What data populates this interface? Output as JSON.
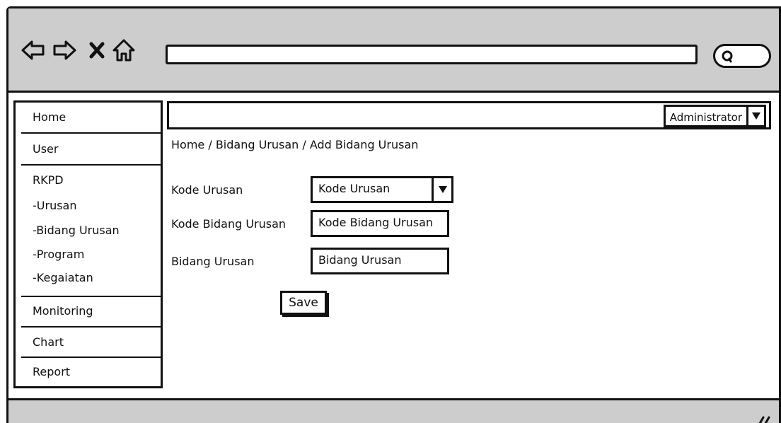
{
  "sidebar": {
    "items": [
      {
        "label": "Home"
      },
      {
        "label": "User"
      },
      {
        "label": "RKPD"
      },
      {
        "label": "-Urusan"
      },
      {
        "label": "-Bidang Urusan"
      },
      {
        "label": "-Program"
      },
      {
        "label": "-Kegaiatan"
      },
      {
        "label": "Monitoring"
      },
      {
        "label": "Chart"
      },
      {
        "label": "Report"
      }
    ]
  },
  "header": {
    "user_menu": {
      "selected": "Administrator"
    }
  },
  "breadcrumb": "Home / Bidang Urusan / Add Bidang Urusan",
  "form": {
    "kode_urusan": {
      "label": "Kode Urusan",
      "value": "Kode Urusan"
    },
    "kode_bidang_urusan": {
      "label": "Kode Bidang Urusan",
      "value": "Kode Bidang Urusan"
    },
    "bidang_urusan": {
      "label": "Bidang Urusan",
      "value": "Bidang Urusan"
    },
    "save_label": "Save"
  },
  "colors": {
    "chrome": "#cdcdcd",
    "ink": "#111111",
    "background": "#ffffff"
  },
  "icons": [
    "back-arrow-icon",
    "forward-arrow-icon",
    "stop-icon",
    "home-icon",
    "search-icon",
    "chevron-down-icon",
    "resize-grip-icon"
  ]
}
